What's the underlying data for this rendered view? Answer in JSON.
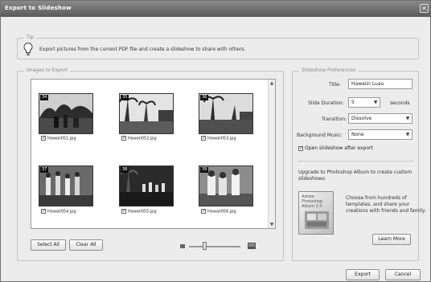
{
  "window": {
    "title": "Export to Slideshow",
    "close_glyph": "✕"
  },
  "tip": {
    "legend": "Tip",
    "icon": "lightbulb-icon",
    "text": "Export pictures from the current PDF file and create a slideshow to share with others."
  },
  "images": {
    "legend": "Images to Export",
    "items": [
      {
        "number": "34",
        "filename": "Hawaii051.jpg",
        "checked": true
      },
      {
        "number": "35",
        "filename": "Hawaii052.jpg",
        "checked": true
      },
      {
        "number": "36",
        "filename": "Hawaii053.jpg",
        "checked": true
      },
      {
        "number": "37",
        "filename": "Hawaii054.jpg",
        "checked": true
      },
      {
        "number": "38",
        "filename": "Hawaii055.jpg",
        "checked": true
      },
      {
        "number": "39",
        "filename": "Hawaii056.jpg",
        "checked": true
      }
    ],
    "select_all_label": "Select All",
    "clear_all_label": "Clear All",
    "zoom_level": 0.3
  },
  "prefs": {
    "legend": "Slideshow Preferences",
    "title_label": "Title:",
    "title_value": "Hawaiin Luau",
    "duration_label": "Slide Duration:",
    "duration_value": "5",
    "duration_unit": "seconds",
    "transition_label": "Transition:",
    "transition_value": "Dissolve",
    "music_label": "Background Music:",
    "music_value": "None",
    "open_after_label": "Open slideshow after export",
    "open_after_checked": true
  },
  "upgrade": {
    "title": "Upgrade to Photoshop Album to create custom slideshows:",
    "product_box_text": "Adobe Photoshop Album 2.0",
    "text": "Choose from hundreds of templates, and share your creations with friends and family.",
    "learn_more_label": "Learn More"
  },
  "footer": {
    "export_label": "Export",
    "cancel_label": "Cancel"
  }
}
